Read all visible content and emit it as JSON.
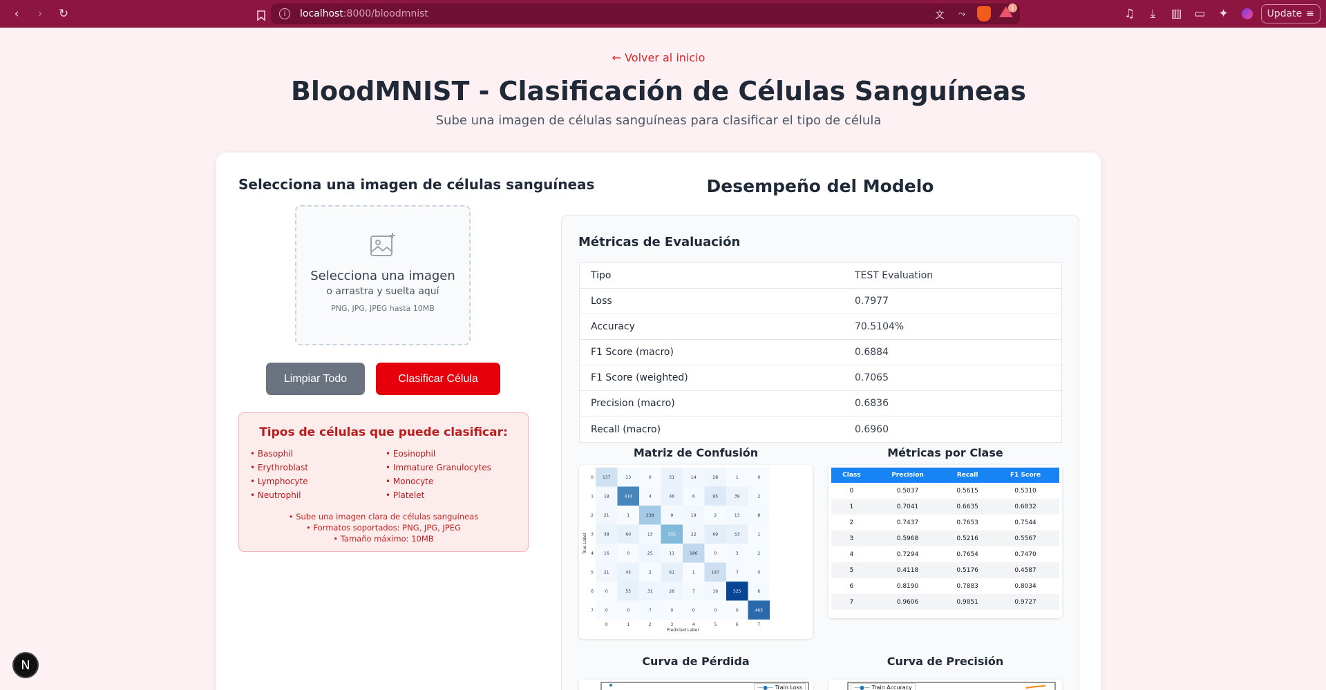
{
  "browser": {
    "url_host": "localhost",
    "url_path": ":8000/bloodmnist",
    "update_label": "Update",
    "alert_count": "1"
  },
  "header": {
    "back_link": "← Volver al inicio",
    "title": "BloodMNIST - Clasificación de Células Sanguíneas",
    "subtitle": "Sube una imagen de células sanguíneas para clasificar el tipo de célula"
  },
  "upload": {
    "heading": "Selecciona una imagen de células sanguíneas",
    "prompt": "Selecciona una imagen",
    "drag_hint": "o arrastra y suelta aquí",
    "formats": "PNG, JPG, JPEG hasta 10MB",
    "clear_label": "Limpiar Todo",
    "classify_label": "Clasificar Célula"
  },
  "cell_types": {
    "heading": "Tipos de células que puede clasificar:",
    "items": [
      "• Basophil",
      "• Eosinophil",
      "• Erythroblast",
      "• Immature Granulocytes",
      "• Lymphocyte",
      "• Monocyte",
      "• Neutrophil",
      "• Platelet"
    ],
    "notes": [
      "• Sube una imagen clara de células sanguíneas",
      "• Formatos soportados: PNG, JPG, JPEG",
      "• Tamaño máximo: 10MB"
    ]
  },
  "performance": {
    "heading": "Desempeño del Modelo",
    "metrics_heading": "Métricas de Evaluación",
    "metrics": [
      {
        "k": "Tipo",
        "v": "TEST Evaluation"
      },
      {
        "k": "Loss",
        "v": "0.7977"
      },
      {
        "k": "Accuracy",
        "v": "70.5104%"
      },
      {
        "k": "F1 Score (macro)",
        "v": "0.6884"
      },
      {
        "k": "F1 Score (weighted)",
        "v": "0.7065"
      },
      {
        "k": "Precision (macro)",
        "v": "0.6836"
      },
      {
        "k": "Recall (macro)",
        "v": "0.6960"
      }
    ],
    "confusion_heading": "Matriz de Confusión",
    "per_class_heading": "Métricas por Clase",
    "loss_heading": "Curva de Pérdida",
    "acc_heading": "Curva de Precisión",
    "loss_legend": "Train Loss",
    "acc_legend": "Train Accuracy"
  },
  "per_class": {
    "headers": [
      "Class",
      "Precision",
      "Recall",
      "F1 Score"
    ],
    "rows": [
      [
        "0",
        "0.5037",
        "0.5615",
        "0.5310"
      ],
      [
        "1",
        "0.7041",
        "0.6635",
        "0.6832"
      ],
      [
        "2",
        "0.7437",
        "0.7653",
        "0.7544"
      ],
      [
        "3",
        "0.5968",
        "0.5216",
        "0.5567"
      ],
      [
        "4",
        "0.7294",
        "0.7654",
        "0.7470"
      ],
      [
        "5",
        "0.4118",
        "0.5176",
        "0.4587"
      ],
      [
        "6",
        "0.8190",
        "0.7883",
        "0.8034"
      ],
      [
        "7",
        "0.9606",
        "0.9851",
        "0.9727"
      ]
    ]
  },
  "chart_data": [
    {
      "type": "heatmap",
      "title": "",
      "xlabel": "Predicted Label",
      "ylabel": "True Label",
      "x_ticks": [
        "0",
        "1",
        "2",
        "3",
        "4",
        "5",
        "6",
        "7"
      ],
      "y_ticks": [
        "0",
        "1",
        "2",
        "3",
        "4",
        "5",
        "6",
        "7"
      ],
      "values": [
        [
          137,
          13,
          0,
          51,
          14,
          28,
          1,
          0
        ],
        [
          18,
          414,
          4,
          46,
          6,
          95,
          39,
          2
        ],
        [
          21,
          1,
          238,
          9,
          19,
          2,
          13,
          8
        ],
        [
          38,
          60,
          13,
          302,
          22,
          69,
          53,
          1
        ],
        [
          16,
          0,
          25,
          11,
          186,
          0,
          3,
          2
        ],
        [
          21,
          45,
          2,
          61,
          1,
          147,
          7,
          0
        ],
        [
          0,
          55,
          31,
          26,
          7,
          16,
          525,
          6
        ],
        [
          0,
          0,
          7,
          0,
          0,
          0,
          0,
          463
        ]
      ],
      "colormap": "Blues"
    }
  ],
  "icons": {
    "image_add": "image-plus-icon",
    "nextjs": "N"
  }
}
